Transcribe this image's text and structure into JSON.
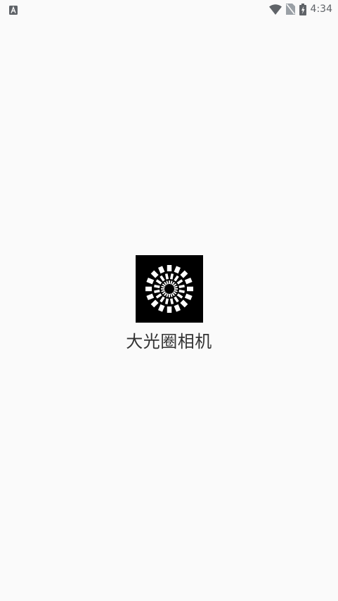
{
  "status_bar": {
    "time": "4:34",
    "icons": [
      "notification-a-icon",
      "wifi-icon",
      "no-sim-icon",
      "battery-charging-icon"
    ]
  },
  "splash": {
    "logo_icon": "aperture-logo-icon",
    "app_name": "大光圈相机"
  },
  "colors": {
    "background": "#fafafa",
    "logo_background": "#000000",
    "text": "#333333",
    "status_icons": "#5f6368"
  }
}
